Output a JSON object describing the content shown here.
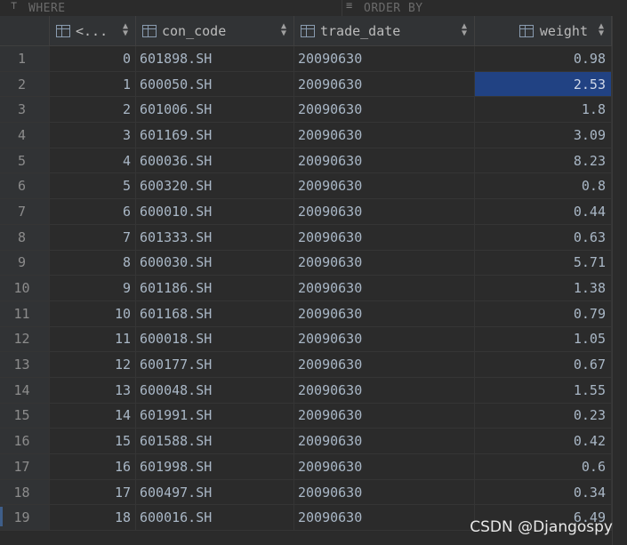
{
  "filter": {
    "where_label": "WHERE",
    "order_label": "ORDER BY"
  },
  "columns": [
    {
      "label": "<...",
      "icon": "table-column-icon"
    },
    {
      "label": "con_code",
      "icon": "table-column-icon"
    },
    {
      "label": "trade_date",
      "icon": "table-column-icon"
    },
    {
      "label": "weight",
      "icon": "table-column-icon"
    }
  ],
  "rows": [
    {
      "num": "1",
      "idx": "0",
      "con_code": "601898.SH",
      "trade_date": "20090630",
      "weight": "0.98"
    },
    {
      "num": "2",
      "idx": "1",
      "con_code": "600050.SH",
      "trade_date": "20090630",
      "weight": "2.53"
    },
    {
      "num": "3",
      "idx": "2",
      "con_code": "601006.SH",
      "trade_date": "20090630",
      "weight": "1.8"
    },
    {
      "num": "4",
      "idx": "3",
      "con_code": "601169.SH",
      "trade_date": "20090630",
      "weight": "3.09"
    },
    {
      "num": "5",
      "idx": "4",
      "con_code": "600036.SH",
      "trade_date": "20090630",
      "weight": "8.23"
    },
    {
      "num": "6",
      "idx": "5",
      "con_code": "600320.SH",
      "trade_date": "20090630",
      "weight": "0.8"
    },
    {
      "num": "7",
      "idx": "6",
      "con_code": "600010.SH",
      "trade_date": "20090630",
      "weight": "0.44"
    },
    {
      "num": "8",
      "idx": "7",
      "con_code": "601333.SH",
      "trade_date": "20090630",
      "weight": "0.63"
    },
    {
      "num": "9",
      "idx": "8",
      "con_code": "600030.SH",
      "trade_date": "20090630",
      "weight": "5.71"
    },
    {
      "num": "10",
      "idx": "9",
      "con_code": "601186.SH",
      "trade_date": "20090630",
      "weight": "1.38"
    },
    {
      "num": "11",
      "idx": "10",
      "con_code": "601168.SH",
      "trade_date": "20090630",
      "weight": "0.79"
    },
    {
      "num": "12",
      "idx": "11",
      "con_code": "600018.SH",
      "trade_date": "20090630",
      "weight": "1.05"
    },
    {
      "num": "13",
      "idx": "12",
      "con_code": "600177.SH",
      "trade_date": "20090630",
      "weight": "0.67"
    },
    {
      "num": "14",
      "idx": "13",
      "con_code": "600048.SH",
      "trade_date": "20090630",
      "weight": "1.55"
    },
    {
      "num": "15",
      "idx": "14",
      "con_code": "601991.SH",
      "trade_date": "20090630",
      "weight": "0.23"
    },
    {
      "num": "16",
      "idx": "15",
      "con_code": "601588.SH",
      "trade_date": "20090630",
      "weight": "0.42"
    },
    {
      "num": "17",
      "idx": "16",
      "con_code": "601998.SH",
      "trade_date": "20090630",
      "weight": "0.6"
    },
    {
      "num": "18",
      "idx": "17",
      "con_code": "600497.SH",
      "trade_date": "20090630",
      "weight": "0.34"
    },
    {
      "num": "19",
      "idx": "18",
      "con_code": "600016.SH",
      "trade_date": "20090630",
      "weight": "6.49"
    }
  ],
  "selected_row": 1,
  "colors": {
    "background": "#2b2b2b",
    "selection": "#214283",
    "text": "#a9b7c6"
  },
  "watermark": "CSDN @Djangospy"
}
